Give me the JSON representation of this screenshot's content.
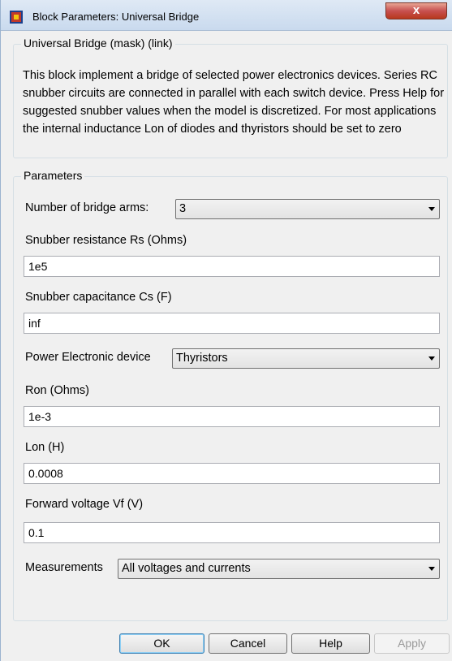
{
  "window": {
    "title": "Block Parameters: Universal Bridge",
    "close_symbol": "x",
    "icon": "simulink-block-icon"
  },
  "description_group": {
    "legend": "Universal Bridge (mask) (link)",
    "text": "This block implement a bridge of selected power electronics devices. Series RC snubber circuits are connected in parallel with each switch device.  Press Help for suggested snubber values when the model is discretized. For most applications the internal inductance Lon of diodes and thyristors should be set to zero"
  },
  "parameters_group": {
    "legend": "Parameters",
    "bridge_arms": {
      "label": "Number of bridge arms:",
      "value": "3"
    },
    "snubber_resistance": {
      "label": "Snubber resistance Rs (Ohms)",
      "value": "1e5"
    },
    "snubber_capacitance": {
      "label": "Snubber capacitance Cs (F)",
      "value": "inf"
    },
    "power_device": {
      "label": "Power Electronic device",
      "value": "Thyristors"
    },
    "ron": {
      "label": "Ron (Ohms)",
      "value": "1e-3"
    },
    "lon": {
      "label": "Lon (H)",
      "value": "0.0008"
    },
    "forward_voltage": {
      "label": "Forward voltage Vf (V)",
      "value": "0.1"
    },
    "measurements": {
      "label": "Measurements",
      "value": "All voltages and currents"
    }
  },
  "buttons": {
    "ok": "OK",
    "cancel": "Cancel",
    "help": "Help",
    "apply": "Apply"
  }
}
